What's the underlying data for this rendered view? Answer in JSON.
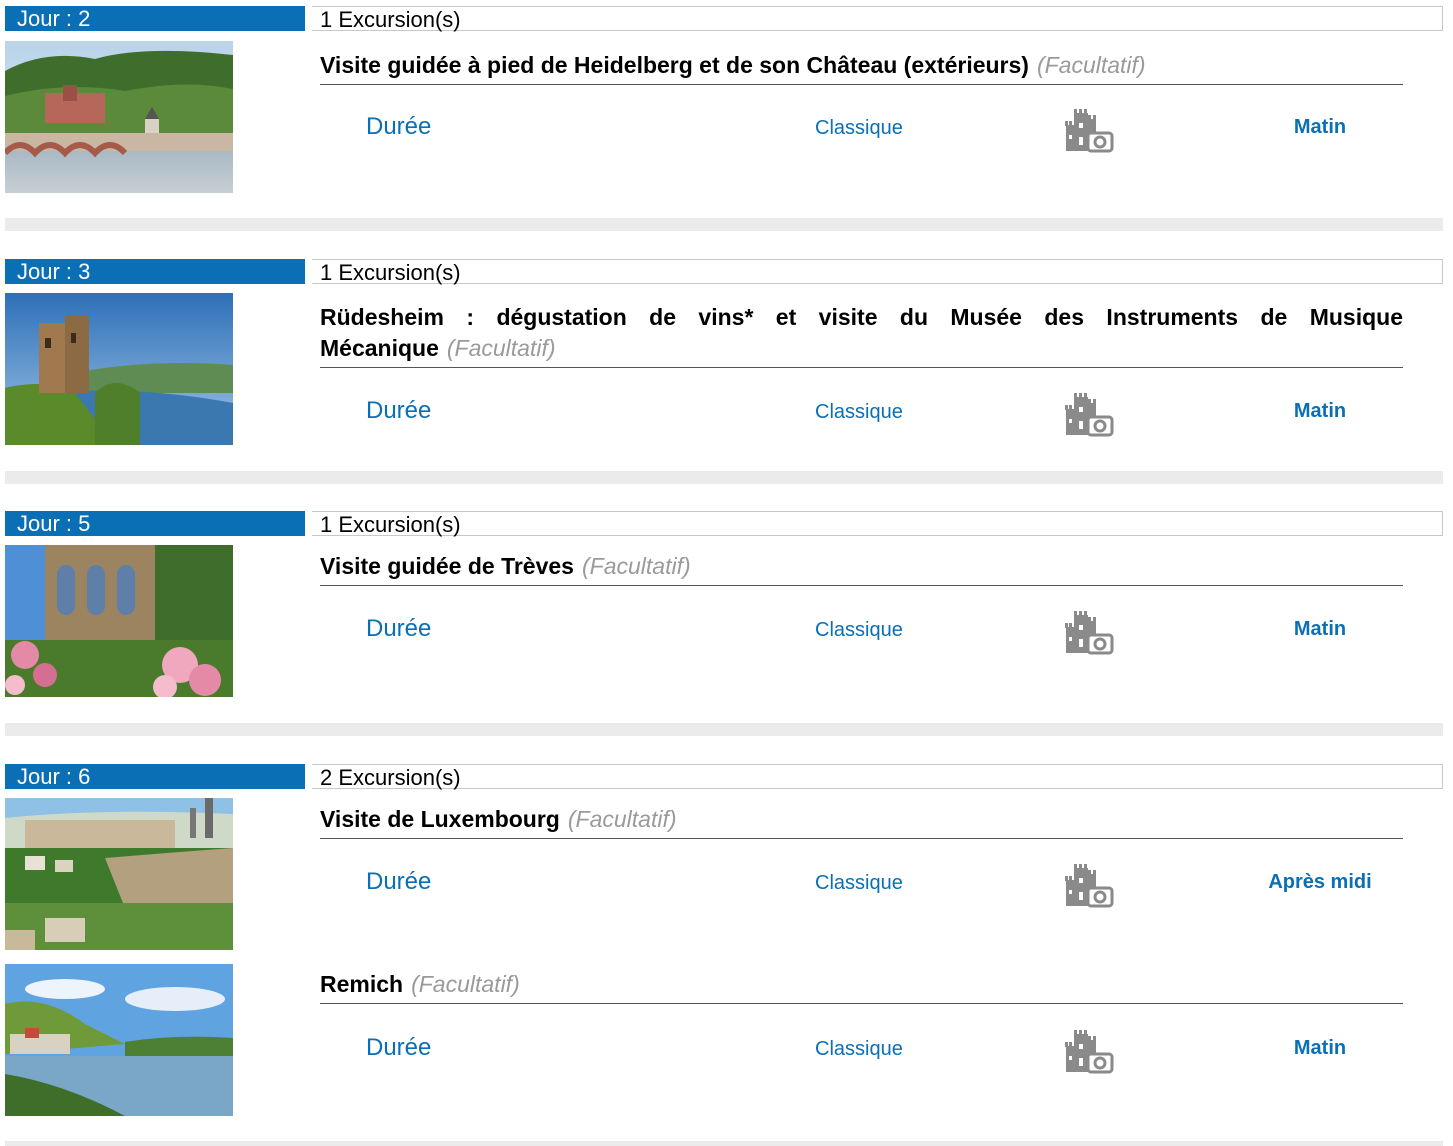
{
  "common": {
    "duration_label": "Durée",
    "category_label": "Classique",
    "optional_label": "(Facultatif)"
  },
  "days": [
    {
      "day_label": "Jour : 2",
      "count_label": "1 Excursion(s)",
      "excursions": [
        {
          "title": "Visite guidée à pied de Heidelberg et de son Château (extérieurs)",
          "period": "Matin",
          "image": "heidelberg-castle-bridge"
        }
      ]
    },
    {
      "day_label": "Jour : 3",
      "count_label": "1 Excursion(s)",
      "excursions": [
        {
          "title": "Rüdesheim : dégustation de vins* et visite du Musée des Instruments de Musique Mécanique",
          "period": "Matin",
          "image": "rhine-castle-tower"
        }
      ]
    },
    {
      "day_label": "Jour : 5",
      "count_label": "1 Excursion(s)",
      "excursions": [
        {
          "title": "Visite guidée de Trèves",
          "period": "Matin",
          "image": "trier-ruins-roses"
        }
      ]
    },
    {
      "day_label": "Jour : 6",
      "count_label": "2 Excursion(s)",
      "excursions": [
        {
          "title": "Visite de Luxembourg",
          "period": "Après midi",
          "image": "luxembourg-city-view"
        },
        {
          "title": "Remich",
          "period": "Matin",
          "image": "remich-river-moselle"
        }
      ]
    }
  ],
  "colors": {
    "accent": "#0a6fb5",
    "separator": "#ebebeb",
    "optional_text": "#9a9a9a",
    "icon_gray": "#8a8a8a"
  },
  "icons": {
    "excursion_type": "castle-camera-icon"
  }
}
